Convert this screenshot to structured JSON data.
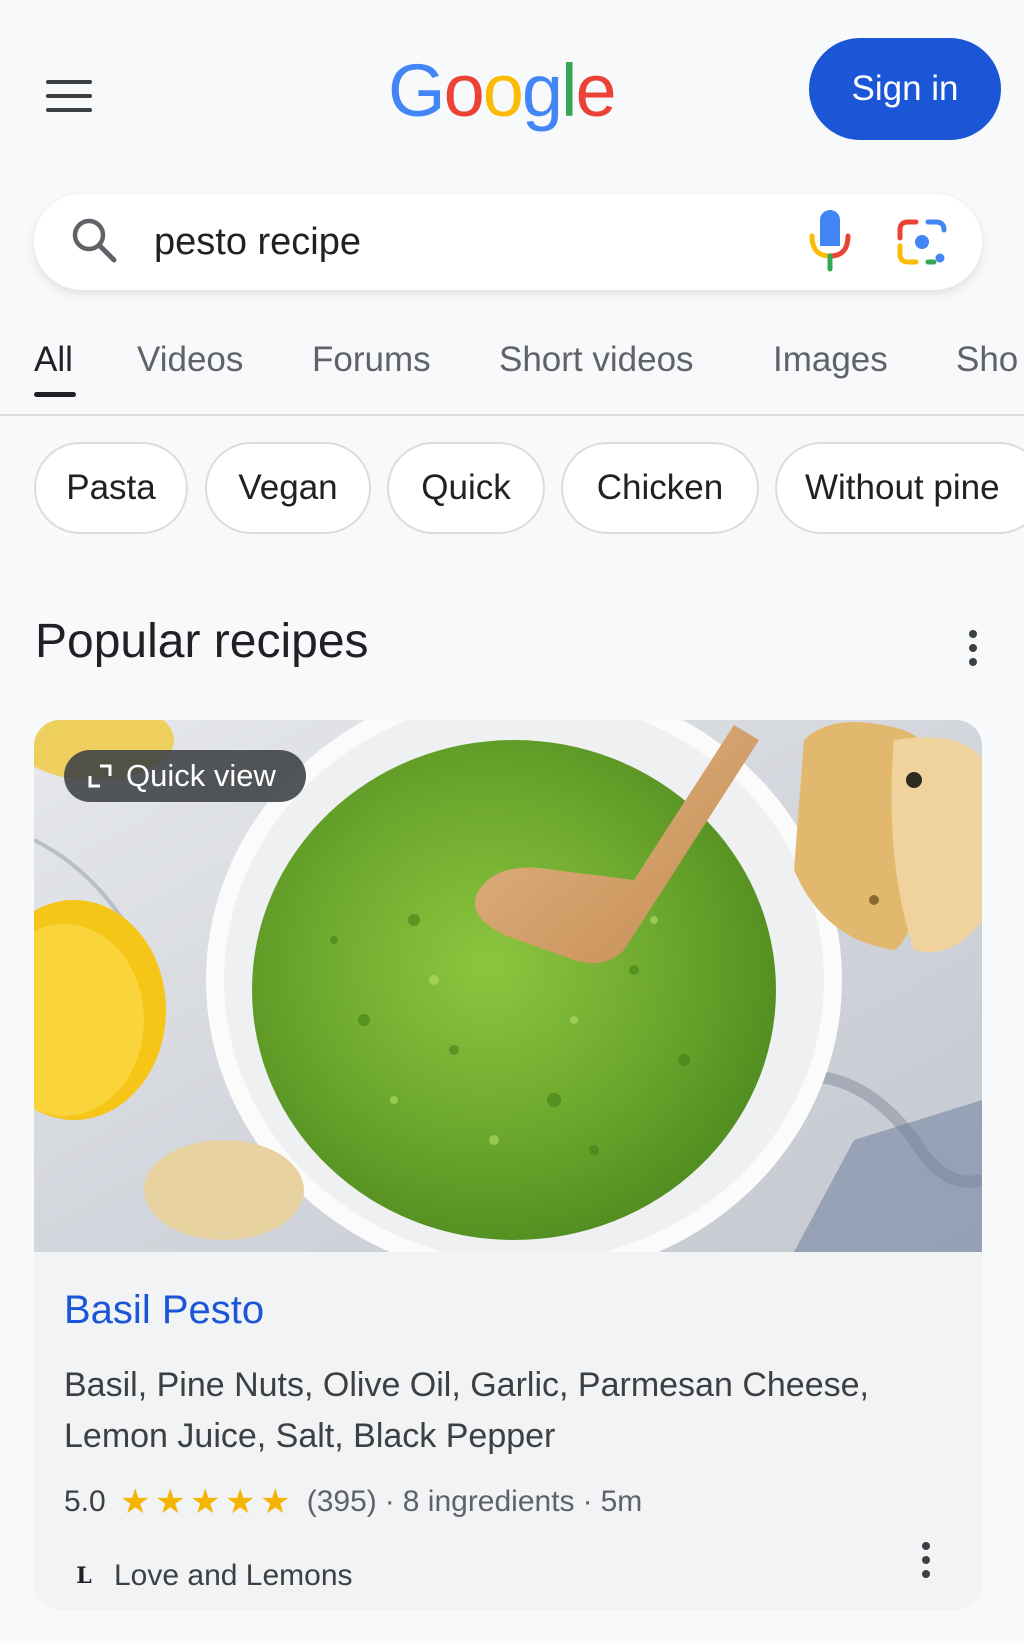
{
  "header": {
    "logo_letters": [
      {
        "ch": "G",
        "color": "#4285F4"
      },
      {
        "ch": "o",
        "color": "#EA4335"
      },
      {
        "ch": "o",
        "color": "#FBBC05"
      },
      {
        "ch": "g",
        "color": "#4285F4"
      },
      {
        "ch": "l",
        "color": "#34A853"
      },
      {
        "ch": "e",
        "color": "#EA4335"
      }
    ],
    "sign_in_label": "Sign in",
    "accent_color": "#1a56d6"
  },
  "search": {
    "query": "pesto recipe",
    "icons": [
      "search-icon",
      "mic-icon",
      "google-lens-icon"
    ]
  },
  "tabs": [
    {
      "label": "All",
      "active": true
    },
    {
      "label": "Videos",
      "active": false
    },
    {
      "label": "Forums",
      "active": false
    },
    {
      "label": "Short videos",
      "active": false
    },
    {
      "label": "Images",
      "active": false
    },
    {
      "label": "Sho",
      "active": false
    }
  ],
  "chips": [
    "Pasta",
    "Vegan",
    "Quick",
    "Chicken",
    "Without pine"
  ],
  "section": {
    "title": "Popular recipes"
  },
  "recipe": {
    "quick_view_label": "Quick view",
    "title": "Basil Pesto",
    "ingredients": "Basil, Pine Nuts, Olive Oil, Garlic, Parmesan Cheese, Lemon Juice, Salt, Black Pepper",
    "rating": "5.0",
    "rating_out_of_5": 5,
    "reviews": "(395)",
    "ingredient_count": "8 ingredients",
    "time": "5m",
    "separator": "·",
    "source_logo": "L",
    "source": "Love and Lemons"
  }
}
